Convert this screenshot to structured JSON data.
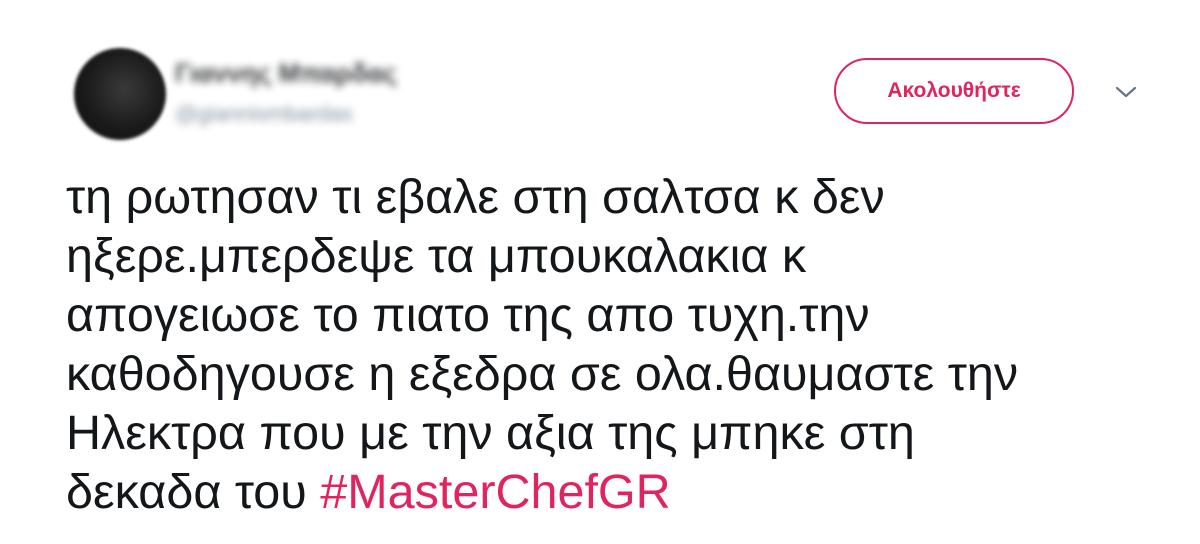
{
  "author": {
    "display_name": "Γιαννης Μπαρδας",
    "handle": "@giannismbardas"
  },
  "actions": {
    "follow_label": "Ακολουθήστε",
    "menu_icon": "chevron-down-icon"
  },
  "tweet": {
    "lines": [
      "τη ρωτησαν τι εβαλε στη σαλτσα κ δεν",
      "ηξερε.μπερδεψε τα μπουκαλακια κ",
      "απογειωσε το πιατο της απο τυχη.την",
      "καθοδηγουσε η εξεδρα σε ολα.θαυμαστε την",
      "Ηλεκτρα που με την αξια της μπηκε στη"
    ],
    "last_line_text": "δεκαδα του ",
    "hashtag": "#MasterChefGR"
  },
  "colors": {
    "accent": "#e0245e",
    "text": "#14171a",
    "secondary_text": "#657786"
  }
}
